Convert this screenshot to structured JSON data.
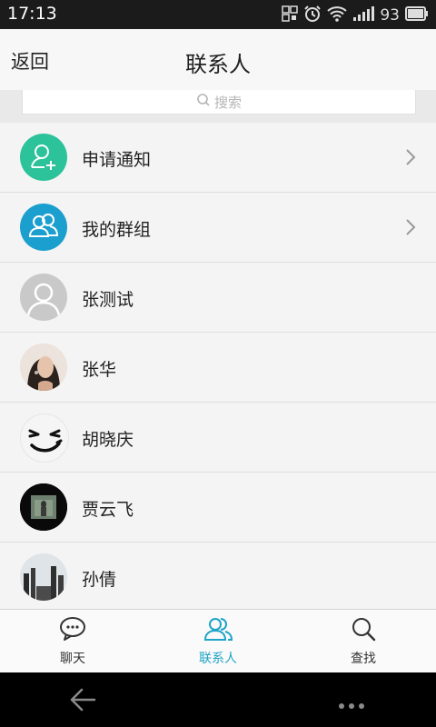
{
  "status": {
    "time": "17:13",
    "battery": "93"
  },
  "header": {
    "back_label": "返回",
    "title": "联系人"
  },
  "search": {
    "placeholder": "搜索"
  },
  "list": {
    "items": [
      {
        "label": "申请通知",
        "kind": "add-user",
        "color": "#2dc39a",
        "arrow": true
      },
      {
        "label": "我的群组",
        "kind": "group",
        "color": "#1a9fce",
        "arrow": true
      },
      {
        "label": "张测试",
        "kind": "default"
      },
      {
        "label": "张华",
        "kind": "photo"
      },
      {
        "label": "胡晓庆",
        "kind": "face"
      },
      {
        "label": "贾云飞",
        "kind": "photo-dark"
      },
      {
        "label": "孙倩",
        "kind": "photo-city"
      }
    ]
  },
  "tabs": [
    {
      "label": "聊天",
      "icon": "chat-bubble-icon",
      "active": false
    },
    {
      "label": "联系人",
      "icon": "contacts-icon",
      "active": true
    },
    {
      "label": "查找",
      "icon": "search-icon",
      "active": false
    }
  ],
  "colors": {
    "accent": "#1ea4c7",
    "status_bar": "#1b1b1b"
  }
}
